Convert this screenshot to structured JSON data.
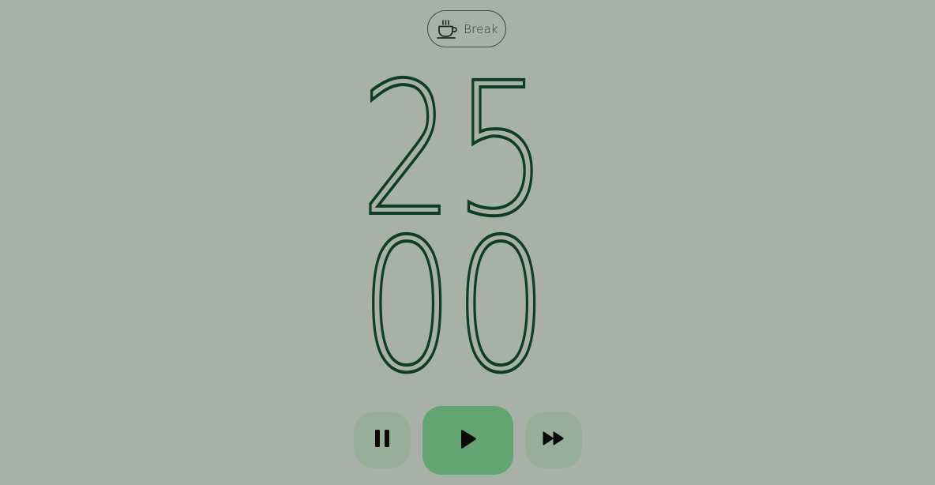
{
  "mode": {
    "label": "Break",
    "icon": "coffee-cup-icon"
  },
  "timer": {
    "minutes": "25",
    "seconds": "00"
  },
  "controls": {
    "pause_icon": "pause-icon",
    "play_icon": "play-icon",
    "skip_icon": "fast-forward-icon"
  },
  "colors": {
    "background": "#a8b1a8",
    "digits": "#0f3d1f",
    "play_button": "#63a572",
    "secondary_button": "#97ae99"
  }
}
